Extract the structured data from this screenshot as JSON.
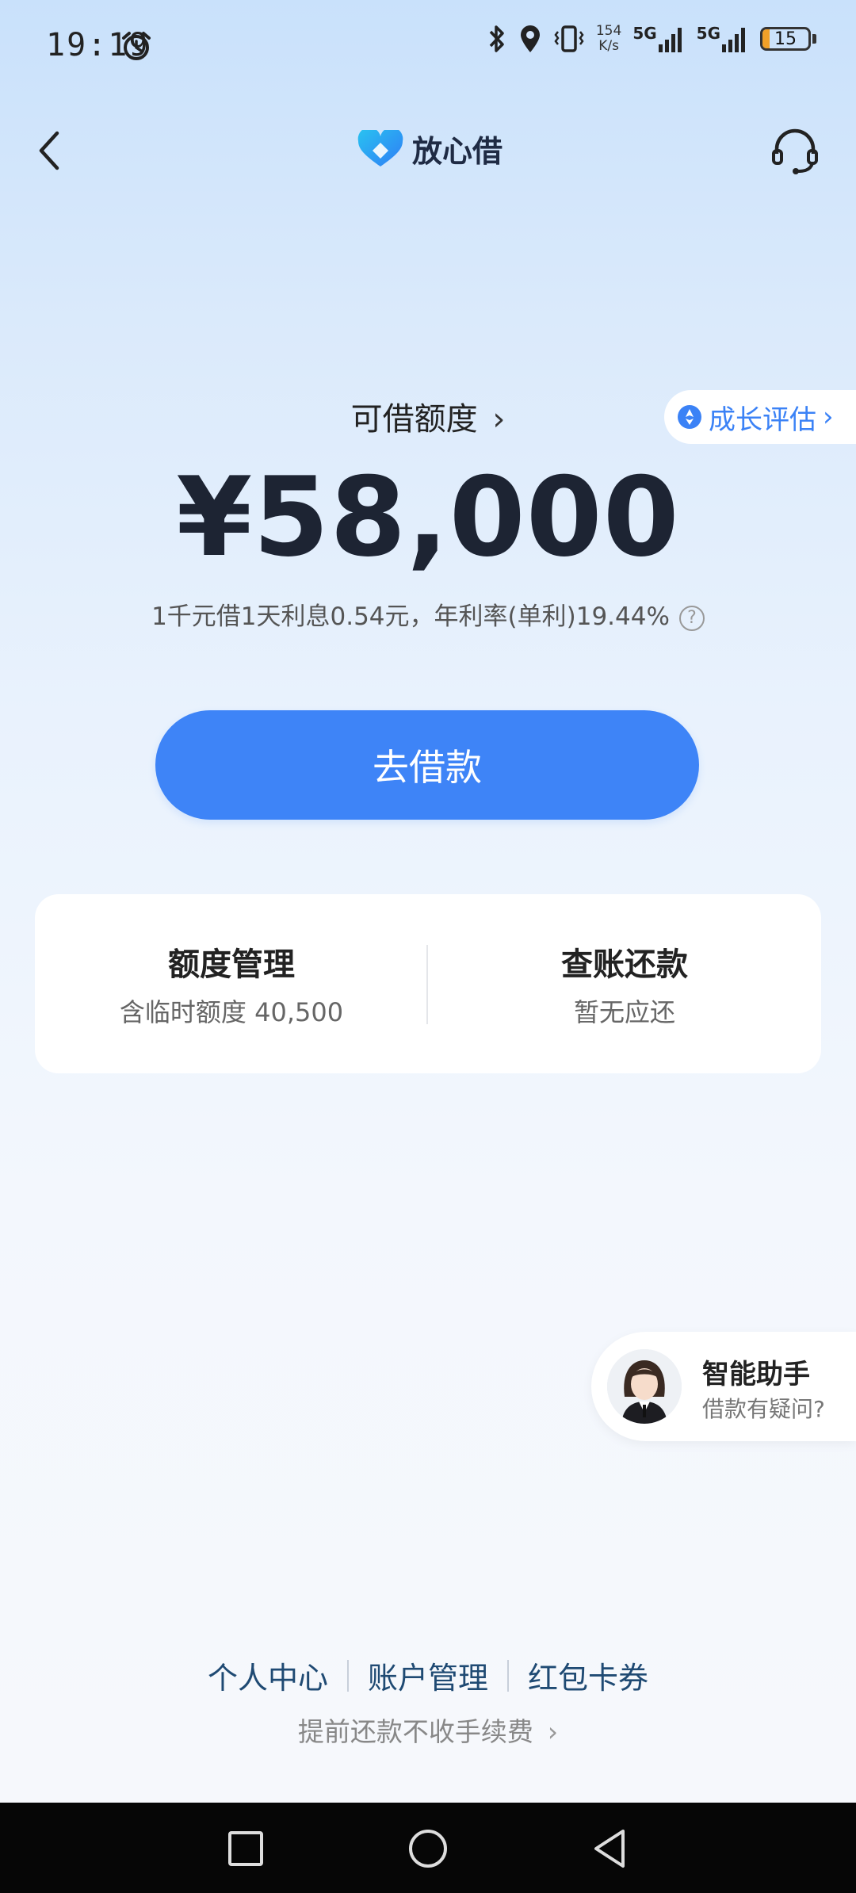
{
  "status_bar": {
    "time": "19:19",
    "net_speed_value": "154",
    "net_speed_unit": "K/s",
    "signal_1": "5G",
    "signal_2": "5G",
    "battery_level": "15",
    "battery_percent": 0.15,
    "icons": [
      "alarm-icon",
      "bluetooth-icon",
      "location-icon",
      "vibrate-icon",
      "signal-icon",
      "battery-icon"
    ]
  },
  "header": {
    "brand_name": "放心借",
    "icons": [
      "back-icon",
      "brand-logo-icon",
      "customer-service-icon"
    ]
  },
  "credit": {
    "title": "可借额度",
    "amount": "¥58,000",
    "rate_text": "1千元借1天利息0.54元，年利率(单利)19.44%",
    "help_icon_text": "?"
  },
  "growth_badge": {
    "label": "成长评估"
  },
  "borrow_button": {
    "label": "去借款"
  },
  "actions": {
    "quota": {
      "title": "额度管理",
      "subtitle": "含临时额度 40,500"
    },
    "repay": {
      "title": "查账还款",
      "subtitle": "暂无应还"
    }
  },
  "assistant": {
    "title": "智能助手",
    "subtitle": "借款有疑问?"
  },
  "footer": {
    "links": [
      "个人中心",
      "账户管理",
      "红包卡券"
    ],
    "prepay_note": "提前还款不收手续费"
  },
  "colors": {
    "primary": "#3e84f7",
    "link": "#1f4a73",
    "battery_low": "#f0a028"
  }
}
